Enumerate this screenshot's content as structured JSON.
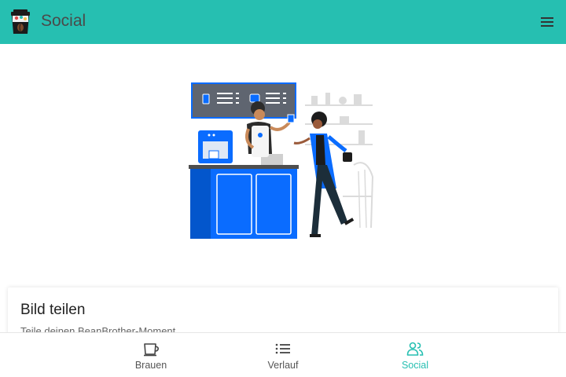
{
  "header": {
    "title": "Social",
    "menu_icon": "menu-icon",
    "logo_icon": "coffee-cup-logo-icon",
    "background_color": "#26bfb1"
  },
  "card": {
    "title": "Bild teilen",
    "subtitle": "Teile deinen BeanBrother-Moment"
  },
  "bottom_nav": {
    "items": [
      {
        "label": "Brauen",
        "icon": "coffee-cup-icon",
        "active": false
      },
      {
        "label": "Verlauf",
        "icon": "list-icon",
        "active": false
      },
      {
        "label": "Social",
        "icon": "people-icon",
        "active": true
      }
    ],
    "active_color": "#26bfb1"
  }
}
